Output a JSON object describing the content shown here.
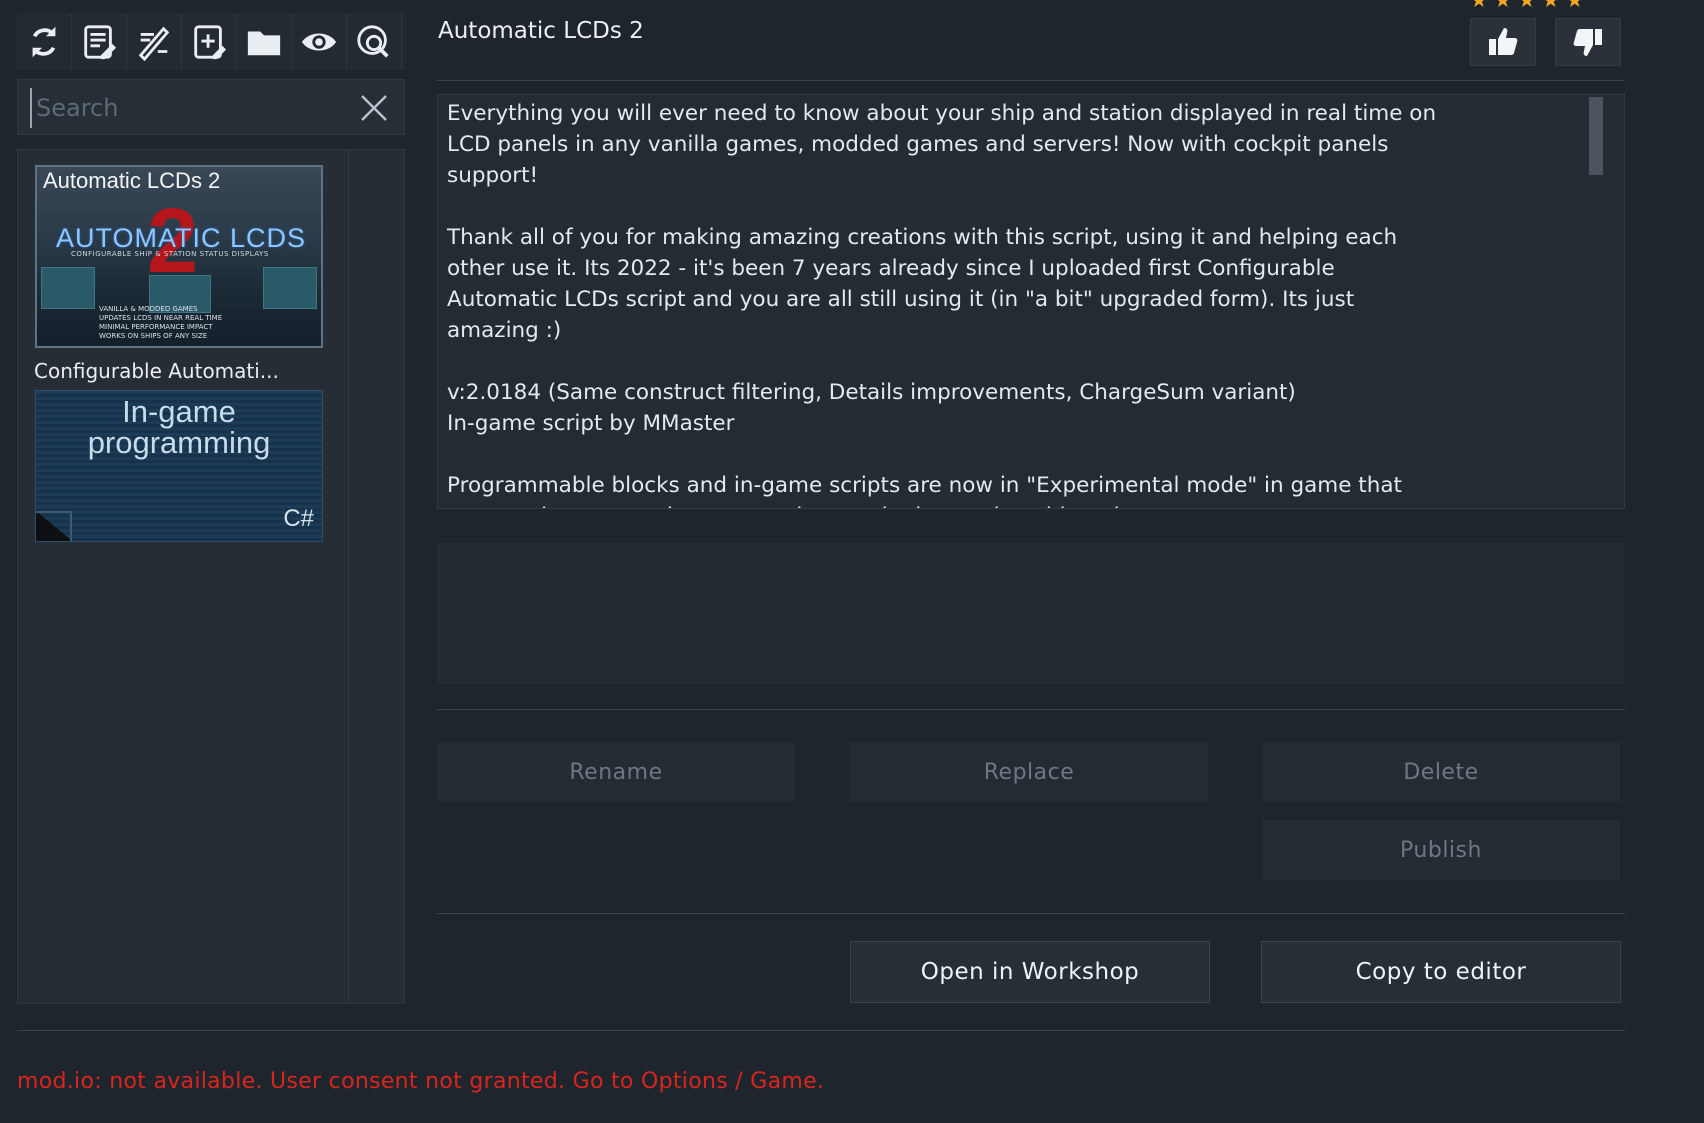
{
  "toolbar": {
    "buttons": [
      {
        "name": "refresh-icon"
      },
      {
        "name": "script-list-icon"
      },
      {
        "name": "edit-script-icon"
      },
      {
        "name": "new-script-icon"
      },
      {
        "name": "folder-icon"
      },
      {
        "name": "eye-icon"
      },
      {
        "name": "workshop-search-icon"
      }
    ]
  },
  "search": {
    "placeholder": "Search",
    "value": ""
  },
  "list": {
    "items": [
      {
        "title": "Automatic LCDs 2",
        "thumb_big": "AUTOMATIC LCDS",
        "thumb_number": "2",
        "thumb_sub": "CONFIGURABLE SHIP & STATION STATUS DISPLAYS",
        "thumb_small": "VANILLA & MODDED GAMES\nUPDATES LCDS IN NEAR REAL TIME\nMINIMAL PERFORMANCE IMPACT\nWORKS ON SHIPS OF ANY SIZE",
        "selected": true
      },
      {
        "title": "Configurable Automati...",
        "thumb_text": "In-game\nprogramming",
        "thumb_logo": "C#"
      }
    ]
  },
  "detail": {
    "title": "Automatic LCDs 2",
    "rating_stars": "★★★★★",
    "description": "Everything you will ever need to know about your ship and station displayed in real time on\nLCD panels in any vanilla games, modded games and servers! Now with cockpit panels\nsupport!\n\nThank all of you for making amazing creations with this script, using it and helping each\nother use it. Its 2022 - it's been 7 years already since I uploaded first Configurable\nAutomatic LCDs script and you are all still using it (in \"a bit\" upgraded form). Its just\namazing :)\n\nv:2.0184 (Same construct filtering, Details improvements, ChargeSum variant)\nIn-game script by MMaster\n\nProgrammable blocks and in-game scripts are now in \"Experimental mode\" in game that\nyou need to turn on in game options and advanced world settings."
  },
  "actions": {
    "rename": "Rename",
    "replace": "Replace",
    "delete": "Delete",
    "publish": "Publish",
    "open_workshop": "Open in Workshop",
    "copy_editor": "Copy to editor"
  },
  "status": "mod.io: not available. User consent not granted. Go to Options / Game.",
  "colors": {
    "background": "#1f252c",
    "error": "#d9251d",
    "stars": "#f1a623"
  }
}
